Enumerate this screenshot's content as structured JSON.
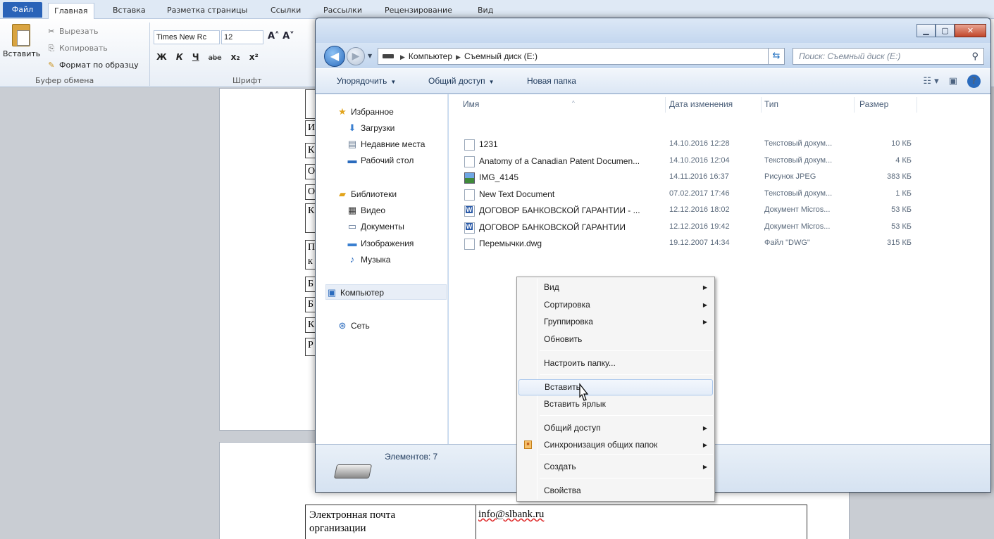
{
  "word": {
    "tabs": [
      "Файл",
      "Главная",
      "Вставка",
      "Разметка страницы",
      "Ссылки",
      "Рассылки",
      "Рецензирование",
      "Вид"
    ],
    "active_tab": "Главная",
    "clipboard": {
      "paste": "Вставить",
      "cut": "Вырезать",
      "copy": "Копировать",
      "format_painter": "Формат по образцу",
      "group_label": "Буфер обмена"
    },
    "font": {
      "family": "Times New Rc",
      "size": "12",
      "group_label": "Шрифт",
      "buttons": [
        "Ж",
        "К",
        "Ч",
        "abe",
        "x₂",
        "x²"
      ]
    },
    "doc_row": {
      "label_line1": "Электронная почта",
      "label_line2": "организации",
      "value": "info@slbank.ru"
    },
    "doc_fragment_letters": [
      "И",
      "К",
      "О",
      "О",
      "К",
      "П",
      "к",
      "Б",
      "Б",
      "К",
      "Р"
    ]
  },
  "explorer": {
    "address": {
      "parts": [
        "Компьютер",
        "Съемный диск (E:)"
      ]
    },
    "search_placeholder": "Поиск: Съемный диск (E:)",
    "commands": {
      "organize": "Упорядочить",
      "share": "Общий доступ",
      "new_folder": "Новая папка"
    },
    "nav": {
      "favorites": "Избранное",
      "downloads": "Загрузки",
      "recent": "Недавние места",
      "desktop": "Рабочий стол",
      "libraries": "Библиотеки",
      "video": "Видео",
      "documents": "Документы",
      "images": "Изображения",
      "music": "Музыка",
      "computer": "Компьютер",
      "network": "Сеть"
    },
    "columns": {
      "name": "Имя",
      "date": "Дата изменения",
      "type": "Тип",
      "size": "Размер"
    },
    "files": [
      {
        "name": "1231",
        "date": "14.10.2016 12:28",
        "type": "Текстовый докум...",
        "size": "10 КБ",
        "icon": "txt-file-icon"
      },
      {
        "name": "Anatomy of a Canadian Patent Documen...",
        "date": "14.10.2016 12:04",
        "type": "Текстовый докум...",
        "size": "4 КБ",
        "icon": "txt-file-icon"
      },
      {
        "name": "IMG_4145",
        "date": "14.11.2016 16:37",
        "type": "Рисунок JPEG",
        "size": "383 КБ",
        "icon": "image-file-icon"
      },
      {
        "name": "New Text Document",
        "date": "07.02.2017 17:46",
        "type": "Текстовый докум...",
        "size": "1 КБ",
        "icon": "txt-file-icon"
      },
      {
        "name": "ДОГОВОР БАНКОВСКОЙ ГАРАНТИИ - ...",
        "date": "12.12.2016 18:02",
        "type": "Документ Micros...",
        "size": "53 КБ",
        "icon": "word-doc-icon"
      },
      {
        "name": "ДОГОВОР БАНКОВСКОЙ ГАРАНТИИ",
        "date": "12.12.2016 19:42",
        "type": "Документ Micros...",
        "size": "53 КБ",
        "icon": "word-doc-icon"
      },
      {
        "name": "Перемычки.dwg",
        "date": "19.12.2007 14:34",
        "type": "Файл \"DWG\"",
        "size": "315 КБ",
        "icon": "dwg-file-icon"
      }
    ],
    "status": "Элементов: 7"
  },
  "context_menu": {
    "items": [
      {
        "label": "Вид",
        "submenu": true
      },
      {
        "label": "Сортировка",
        "submenu": true
      },
      {
        "label": "Группировка",
        "submenu": true
      },
      {
        "label": "Обновить",
        "submenu": false
      },
      {
        "label": "Настроить папку...",
        "submenu": false
      },
      {
        "label": "Вставить",
        "submenu": false,
        "highlighted": true
      },
      {
        "label": "Вставить ярлык",
        "submenu": false
      },
      {
        "label": "Общий доступ",
        "submenu": true
      },
      {
        "label": "Синхронизация общих папок",
        "submenu": true
      },
      {
        "label": "Создать",
        "submenu": true
      },
      {
        "label": "Свойства",
        "submenu": false
      }
    ]
  }
}
